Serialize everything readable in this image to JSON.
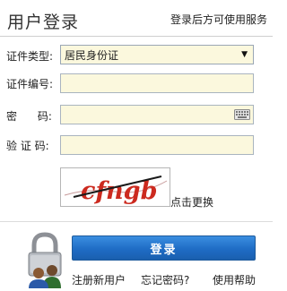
{
  "header": {
    "title": "用户登录",
    "subtitle": "登录后方可使用服务"
  },
  "form": {
    "cert_type": {
      "label": "证件类型:",
      "value": "居民身份证"
    },
    "cert_number": {
      "label": "证件编号:",
      "value": ""
    },
    "password": {
      "label": "密      码:",
      "value": ""
    },
    "captcha_field": {
      "label": "验 证 码:",
      "value": ""
    },
    "captcha_image_text": "cfngb",
    "refresh_link": "点击更换"
  },
  "actions": {
    "login_label": "登录",
    "links": [
      "注册新用户",
      "忘记密码?",
      "使用帮助"
    ]
  },
  "colors": {
    "field_bg": "#fbf8dd",
    "button_blue": "#1f6cc5"
  },
  "icons": [
    "chevron-down-icon",
    "keyboard-icon",
    "lock-users-icon"
  ]
}
